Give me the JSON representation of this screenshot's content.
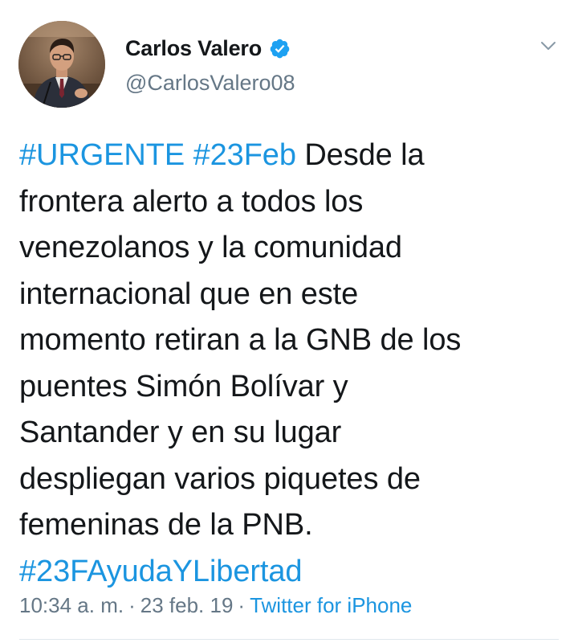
{
  "user": {
    "display_name": "Carlos Valero",
    "handle": "@CarlosValero08",
    "verified_icon": "verified-badge-icon",
    "avatar_icon": "profile-photo"
  },
  "menu": {
    "caret_icon": "chevron-down-icon"
  },
  "tweet": {
    "lines": [
      [
        {
          "text": "#URGENTE",
          "hashtag": true
        },
        {
          "text": " ",
          "hashtag": false
        },
        {
          "text": "#23Feb",
          "hashtag": true
        },
        {
          "text": " Desde la",
          "hashtag": false
        }
      ],
      [
        {
          "text": "frontera alerto a todos los",
          "hashtag": false
        }
      ],
      [
        {
          "text": "venezolanos y la comunidad",
          "hashtag": false
        }
      ],
      [
        {
          "text": "internacional que en este",
          "hashtag": false
        }
      ],
      [
        {
          "text": "momento retiran a la GNB de los",
          "hashtag": false
        }
      ],
      [
        {
          "text": "puentes Simón Bolívar y",
          "hashtag": false
        }
      ],
      [
        {
          "text": "Santander y en su lugar",
          "hashtag": false
        }
      ],
      [
        {
          "text": "despliegan varios piquetes de",
          "hashtag": false
        }
      ],
      [
        {
          "text": "femeninas de la PNB.",
          "hashtag": false
        }
      ],
      [
        {
          "text": "#23FAyudaYLibertad",
          "hashtag": true
        }
      ]
    ]
  },
  "meta": {
    "time": "10:34 a. m.",
    "separator": "·",
    "date": "23 feb. 19",
    "source": "Twitter for iPhone"
  },
  "colors": {
    "link": "#1b95e0",
    "text": "#14171a",
    "secondary": "#657786",
    "divider": "#e1e8ed"
  }
}
